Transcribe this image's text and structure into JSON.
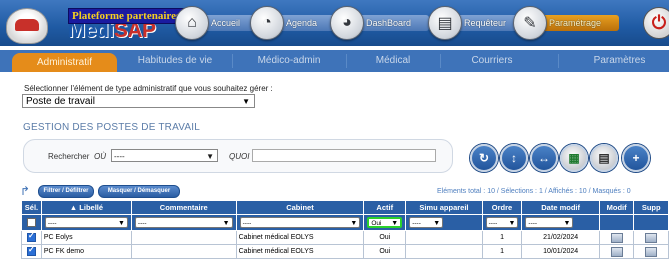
{
  "app": {
    "logo_text_main": "Medi",
    "logo_text_accent": "SAP",
    "partner_badge": "Plateforme partenaires"
  },
  "nav": [
    {
      "label": "Accueil",
      "icon": "home-icon",
      "active": false
    },
    {
      "label": "Agenda",
      "icon": "agenda-icon",
      "active": false
    },
    {
      "label": "DashBoard",
      "icon": "dashboard-icon",
      "active": false
    },
    {
      "label": "Requêteur",
      "icon": "printer-icon",
      "active": false
    },
    {
      "label": "Paramétrage",
      "icon": "wrench-icon",
      "active": true
    }
  ],
  "tabs": [
    {
      "label": "Administratif",
      "active": true
    },
    {
      "label": "Habitudes de vie",
      "active": false
    },
    {
      "label": "Médico-admin",
      "active": false
    },
    {
      "label": "Médical",
      "active": false
    },
    {
      "label": "Courriers",
      "active": false
    },
    {
      "label": "Paramètres",
      "active": false
    }
  ],
  "selector": {
    "label": "Sélectionner l'élément de type administratif que vous souhaitez gérer :",
    "value": "Poste de travail"
  },
  "section_title": "GESTION DES POSTES DE TRAVAIL",
  "search": {
    "rechercher_label": "Rechercher",
    "ou_label": "OÙ",
    "ou_value": "----",
    "quoi_label": "QUOI",
    "quoi_value": ""
  },
  "actions": {
    "filter_label": "Filtrer / Défiltrer",
    "mask_label": "Masquer / Démasquer",
    "counts": "Eléments total : 10 / Sélections : 1 / Affichés : 10 / Masqués : 0"
  },
  "table": {
    "headers": [
      "Sél.",
      "▲ Libellé",
      "Commentaire",
      "Cabinet",
      "Actif",
      "Simu appareil",
      "Ordre",
      "Date modif",
      "Modif",
      "Supp"
    ],
    "filters": {
      "libelle": "----",
      "commentaire": "----",
      "cabinet": "----",
      "actif": "Oui",
      "simu": "----",
      "ordre": "----",
      "date": "----"
    },
    "rows": [
      {
        "libelle": "PC Eolys",
        "commentaire": "",
        "cabinet": "Cabinet médical EOLYS",
        "actif": "Oui",
        "simu": "",
        "ordre": "1",
        "date": "21/02/2024",
        "selected": true
      },
      {
        "libelle": "PC FK demo",
        "commentaire": "",
        "cabinet": "Cabinet médical EOLYS",
        "actif": "Oui",
        "simu": "",
        "ordre": "1",
        "date": "10/01/2024",
        "selected": true
      }
    ]
  },
  "colors": {
    "header_blue": "#2a5fa5",
    "tab_active": "#e58c1a",
    "nav_active": "#e8a020"
  }
}
